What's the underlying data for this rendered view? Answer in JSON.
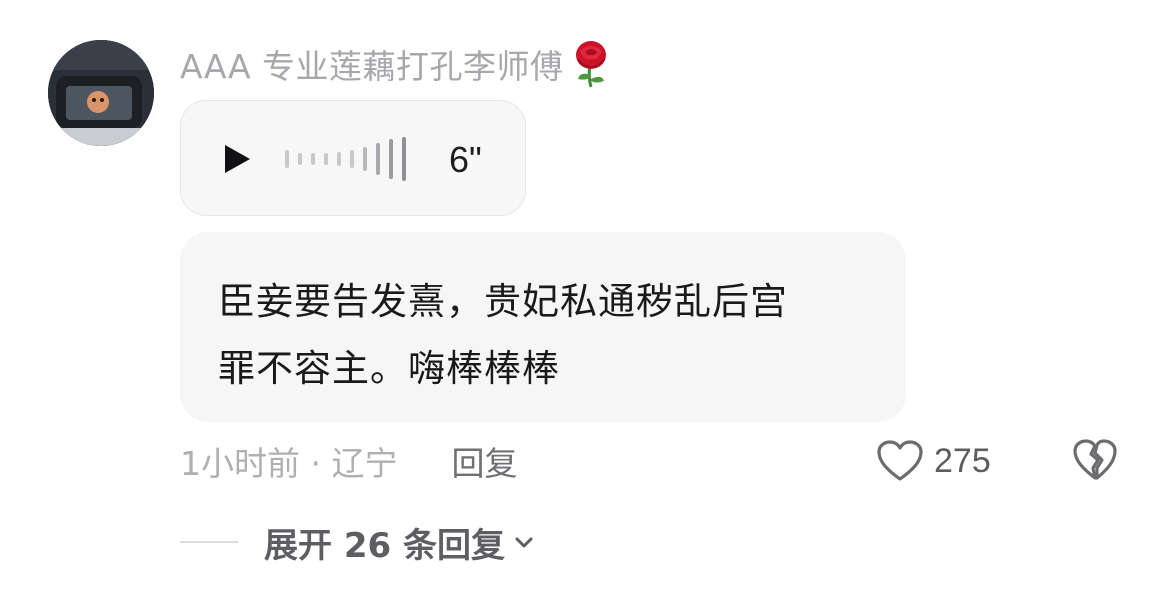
{
  "comment": {
    "username": "AAA 专业莲藕打孔李师傅",
    "username_emoji": "rose-icon",
    "voice": {
      "duration": "6\""
    },
    "text_line1": "臣妾要告发熹，贵妃私通秽乱后宫",
    "text_line2": "罪不容主。嗨棒棒棒",
    "time_location": "1小时前 · 辽宁",
    "reply_label": "回复",
    "like_count": "275",
    "expand_replies": "展开 26 条回复"
  },
  "colors": {
    "username": "#a7a7ac",
    "bubble_bg": "#f6f6f7",
    "text": "#1a1a1c",
    "meta": "#b0b0b4",
    "reply": "#6f6f74"
  }
}
